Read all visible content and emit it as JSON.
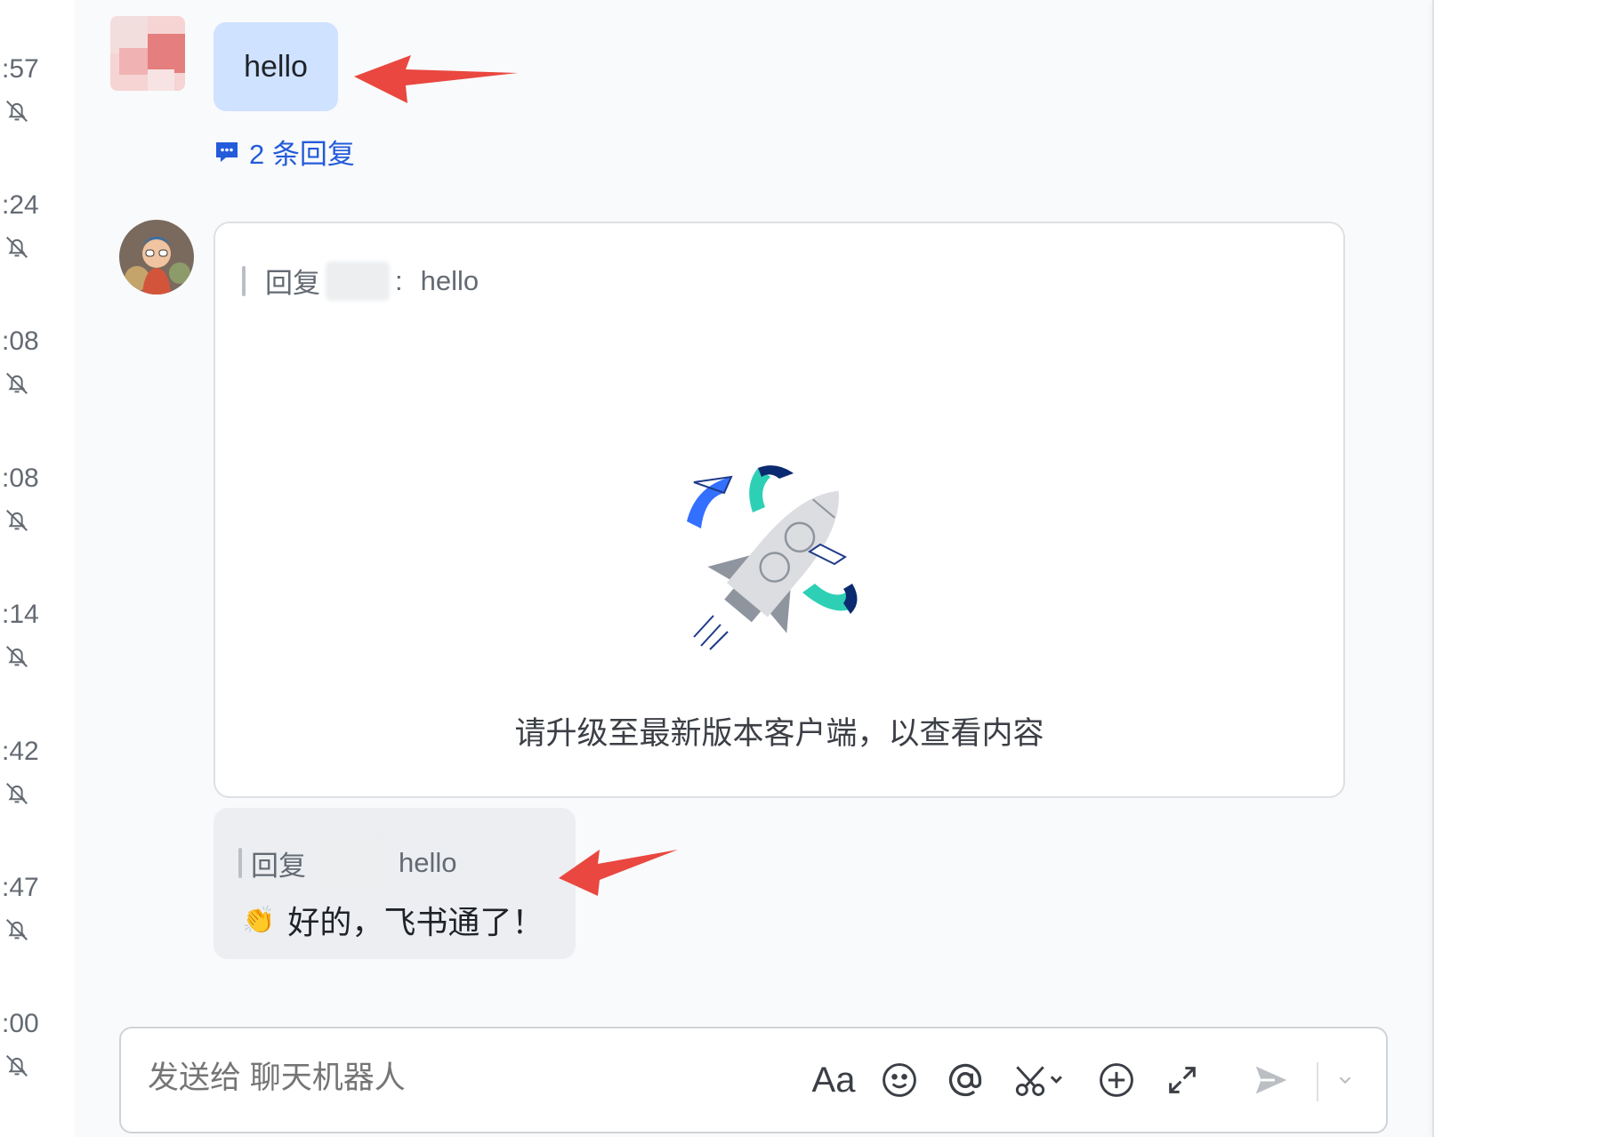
{
  "times": [
    ":57",
    ":24",
    ":08",
    ":08",
    ":14",
    ":42",
    ":47",
    ":00"
  ],
  "messages": {
    "first": {
      "text": "hello",
      "replies": "2 条回复"
    },
    "card": {
      "quote_prefix": "回复",
      "quote_sep": ":",
      "quote_text": "hello",
      "tip": "请升级至最新版本客户端，以查看内容"
    },
    "reply": {
      "quote_prefix": "回复",
      "quote_text": "hello",
      "emoji": "👏",
      "text": "好的，飞书通了！"
    }
  },
  "composer": {
    "placeholder": "发送给 聊天机器人",
    "format_label": "Aa"
  },
  "colors": {
    "accent": "#245bdb",
    "bubble_self": "#cfe2ff",
    "arrow": "#e9473f"
  }
}
